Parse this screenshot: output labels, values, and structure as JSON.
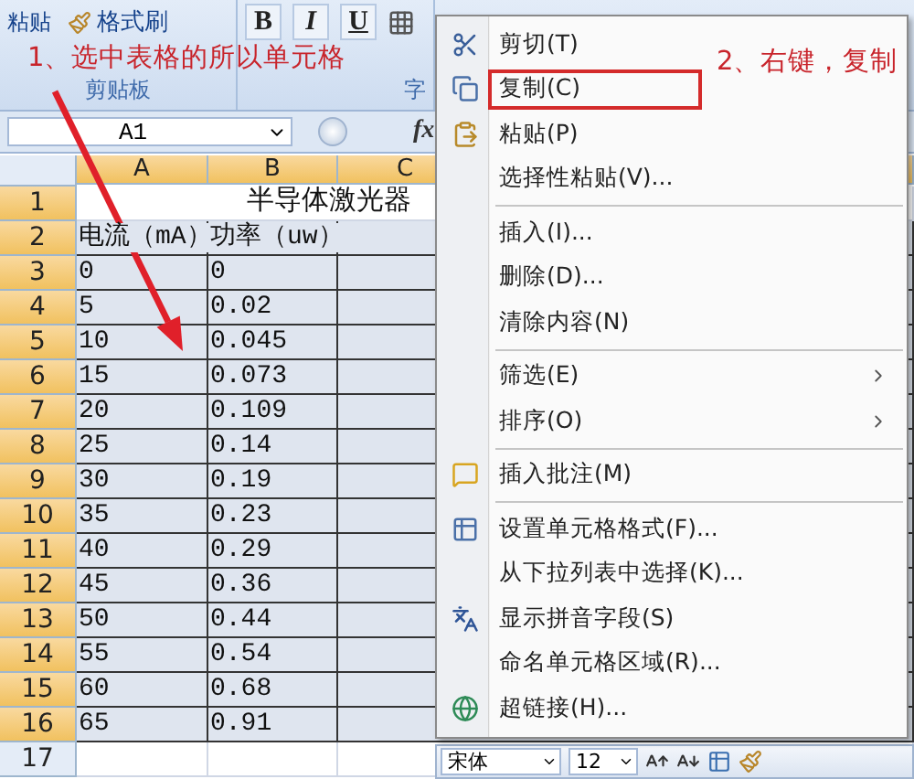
{
  "ribbon": {
    "paste": "粘贴",
    "format_painter": "格式刷",
    "clipboard_group": "剪贴板",
    "bold": "B",
    "italic": "I",
    "underline": "U",
    "font_group": "字"
  },
  "annotations": [
    {
      "text": "1、选中表格的所以单元格"
    },
    {
      "text": "2、右键，复制"
    }
  ],
  "formula_bar": {
    "name_box": "A1",
    "fx": "fx"
  },
  "columns": [
    {
      "label": "A",
      "selected": true
    },
    {
      "label": "B",
      "selected": true
    },
    {
      "label": "C",
      "selected": true
    }
  ],
  "rows": [
    {
      "number": "1",
      "selected": true,
      "active": true,
      "kind": "title",
      "title": "半导体激光器"
    },
    {
      "number": "2",
      "selected": true,
      "kind": "data",
      "cells": [
        "电流（mA）",
        "功率（uw）"
      ]
    },
    {
      "number": "3",
      "selected": true,
      "kind": "data",
      "cells": [
        "0",
        "0"
      ]
    },
    {
      "number": "4",
      "selected": true,
      "kind": "data",
      "cells": [
        "5",
        "0.02"
      ]
    },
    {
      "number": "5",
      "selected": true,
      "kind": "data",
      "cells": [
        "10",
        "0.045"
      ]
    },
    {
      "number": "6",
      "selected": true,
      "kind": "data",
      "cells": [
        "15",
        "0.073"
      ]
    },
    {
      "number": "7",
      "selected": true,
      "kind": "data",
      "cells": [
        "20",
        "0.109"
      ]
    },
    {
      "number": "8",
      "selected": true,
      "kind": "data",
      "cells": [
        "25",
        "0.14"
      ]
    },
    {
      "number": "9",
      "selected": true,
      "kind": "data",
      "cells": [
        "30",
        "0.19"
      ]
    },
    {
      "number": "10",
      "selected": true,
      "kind": "data",
      "cells": [
        "35",
        "0.23"
      ]
    },
    {
      "number": "11",
      "selected": true,
      "kind": "data",
      "cells": [
        "40",
        "0.29"
      ]
    },
    {
      "number": "12",
      "selected": true,
      "kind": "data",
      "cells": [
        "45",
        "0.36"
      ]
    },
    {
      "number": "13",
      "selected": true,
      "kind": "data",
      "cells": [
        "50",
        "0.44"
      ]
    },
    {
      "number": "14",
      "selected": true,
      "kind": "data",
      "cells": [
        "55",
        "0.54"
      ]
    },
    {
      "number": "15",
      "selected": true,
      "kind": "data",
      "cells": [
        "60",
        "0.68"
      ]
    },
    {
      "number": "16",
      "selected": true,
      "kind": "data",
      "cells": [
        "65",
        "0.91"
      ]
    },
    {
      "number": "17",
      "selected": false,
      "kind": "data"
    }
  ],
  "context_menu": [
    {
      "kind": "item",
      "label": "剪切(T)",
      "highlighted": false,
      "submenu": false
    },
    {
      "kind": "item",
      "label": "复制(C)",
      "highlighted": true,
      "submenu": false
    },
    {
      "kind": "item",
      "label": "粘贴(P)",
      "highlighted": false,
      "submenu": false
    },
    {
      "kind": "item",
      "label": "选择性粘贴(V)...",
      "highlighted": false,
      "submenu": false
    },
    {
      "kind": "separator"
    },
    {
      "kind": "item",
      "label": "插入(I)...",
      "highlighted": false,
      "submenu": false
    },
    {
      "kind": "item",
      "label": "删除(D)...",
      "highlighted": false,
      "submenu": false
    },
    {
      "kind": "item",
      "label": "清除内容(N)",
      "highlighted": false,
      "submenu": false
    },
    {
      "kind": "separator"
    },
    {
      "kind": "item",
      "label": "筛选(E)",
      "highlighted": false,
      "submenu": true
    },
    {
      "kind": "item",
      "label": "排序(O)",
      "highlighted": false,
      "submenu": true
    },
    {
      "kind": "separator"
    },
    {
      "kind": "item",
      "label": "插入批注(M)",
      "highlighted": false,
      "submenu": false
    },
    {
      "kind": "separator"
    },
    {
      "kind": "item",
      "label": "设置单元格格式(F)...",
      "highlighted": false,
      "submenu": false
    },
    {
      "kind": "item",
      "label": "从下拉列表中选择(K)...",
      "highlighted": false,
      "submenu": false
    },
    {
      "kind": "item",
      "label": "显示拼音字段(S)",
      "highlighted": false,
      "submenu": false
    },
    {
      "kind": "item",
      "label": "命名单元格区域(R)...",
      "highlighted": false,
      "submenu": false
    },
    {
      "kind": "item",
      "label": "超链接(H)...",
      "highlighted": false,
      "submenu": false
    }
  ],
  "mini_toolbar": {
    "font": "宋体",
    "size": "12"
  }
}
